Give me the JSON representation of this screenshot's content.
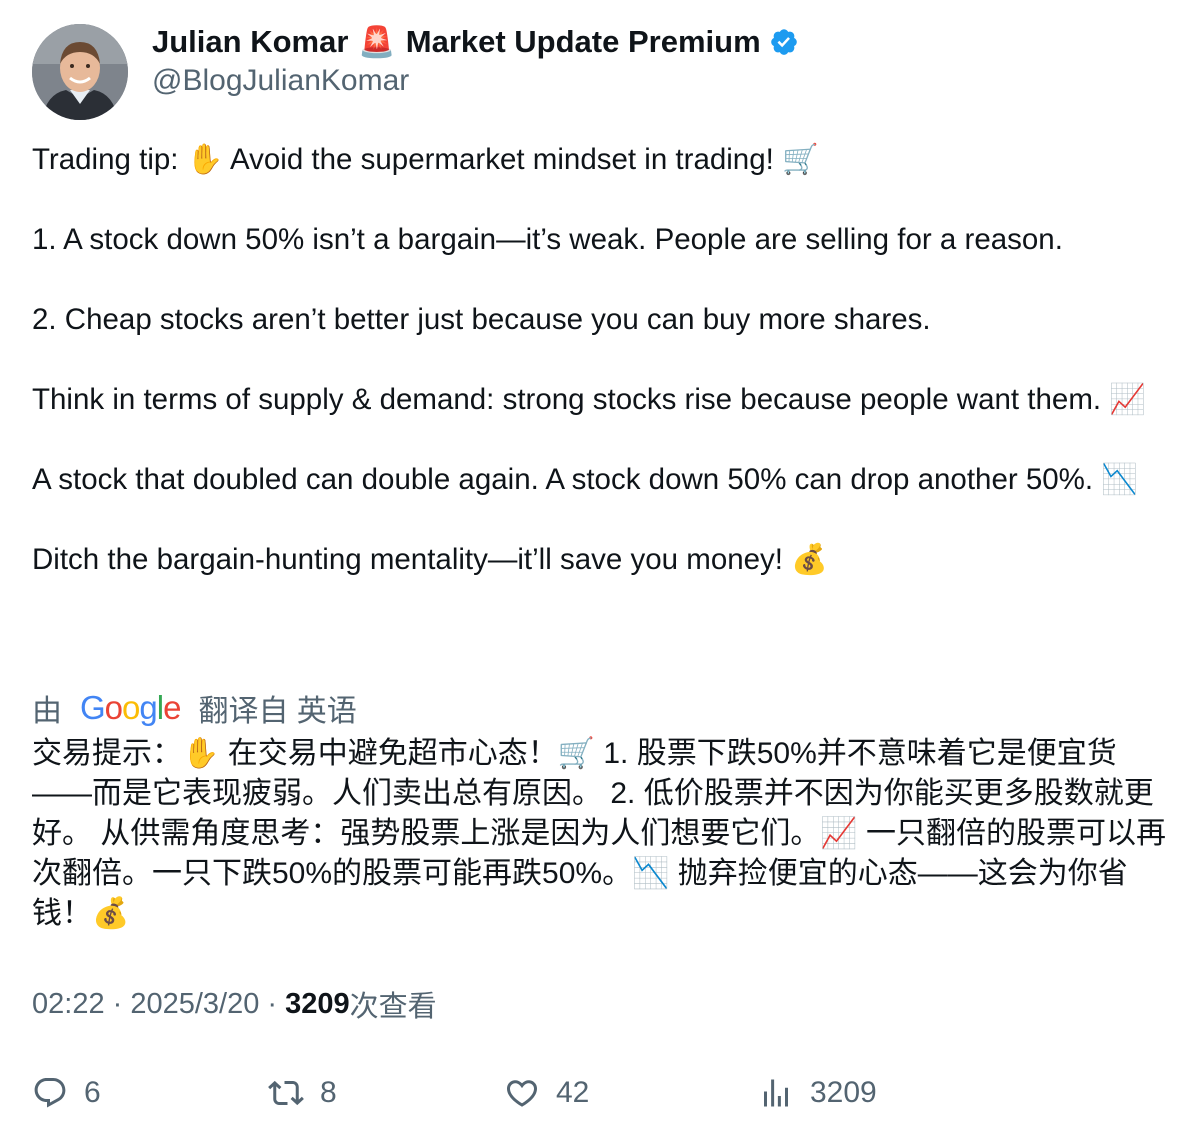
{
  "author": {
    "name": "Julian Komar",
    "badge_emoji": "🚨",
    "name_suffix": "Market Update Premium",
    "verified_icon": "verified-badge-icon",
    "handle": "@BlogJulianKomar"
  },
  "tweet": {
    "text": "Trading tip: ✋ Avoid the supermarket mindset in trading! 🛒\n\n1. A stock down 50% isn’t a bargain—it’s weak. People are selling for a reason.\n\n2. Cheap stocks aren’t better just because you can buy more shares.\n\nThink in terms of supply & demand: strong stocks rise because people want them. 📈\n\nA stock that doubled can double again. A stock down 50% can drop another 50%. 📉\n\nDitch the bargain-hunting mentality—it’ll save you money! 💰"
  },
  "translation": {
    "prefix": "由",
    "provider": "Google",
    "suffix": "翻译自 英语",
    "text": "交易提示：✋ 在交易中避免超市心态！🛒 1. 股票下跌50%并不意味着它是便宜货——而是它表现疲弱。人们卖出总有原因。 2. 低价股票并不因为你能买更多股数就更好。 从供需角度思考：强势股票上涨是因为人们想要它们。📈 一只翻倍的股票可以再次翻倍。一只下跌50%的股票可能再跌50%。📉 抛弃捡便宜的心态——这会为你省钱！💰"
  },
  "meta": {
    "time": "02:22",
    "separator": " · ",
    "date": "2025/3/20",
    "views_count": "3209",
    "views_label": "次查看"
  },
  "actions": {
    "reply": {
      "icon": "reply-icon",
      "count": "6"
    },
    "retweet": {
      "icon": "retweet-icon",
      "count": "8"
    },
    "like": {
      "icon": "heart-icon",
      "count": "42"
    },
    "views": {
      "icon": "analytics-icon",
      "count": "3209"
    }
  },
  "colors": {
    "text": "#0f1419",
    "secondary": "#536471",
    "verified": "#1d9bf0"
  }
}
